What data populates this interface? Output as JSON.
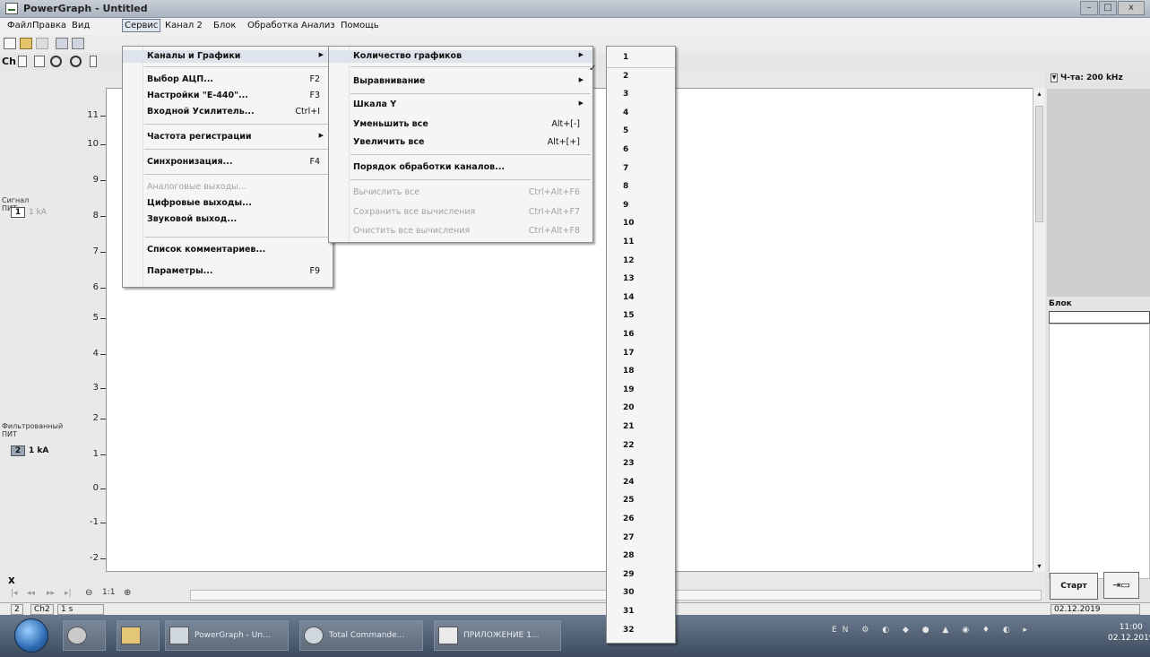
{
  "window": {
    "title": "PowerGraph - Untitled",
    "buttons": [
      "–",
      "□",
      "x"
    ]
  },
  "menubar": [
    "Файл",
    "Правка",
    "Вид",
    "Сервис",
    "Канал 2",
    "Блок",
    "Обработка",
    "Анализ",
    "Помощь"
  ],
  "toolbar2": {
    "ch_label": "Ch"
  },
  "right_panel": {
    "rate_label": "Ч-та: 200 kHz",
    "block_label": "Блок",
    "start_button": "Старт"
  },
  "left_panel": {
    "y_labels": [
      "11",
      "10",
      "9",
      "8",
      "7",
      "6",
      "5",
      "4",
      "3",
      "2",
      "1",
      "0",
      "-1",
      "-2"
    ],
    "channel1": {
      "name": "Сигнал ПИТ",
      "num": "1",
      "scale": "1 kA"
    },
    "channel2": {
      "name": "Фильтрованный ПИТ",
      "num": "2",
      "scale": "1 kA"
    }
  },
  "bottom": {
    "close": "x",
    "zoom_ratio": "1:1",
    "status": [
      "2",
      "Ch2",
      "1 s",
      "02.12.2019"
    ]
  },
  "taskbar": {
    "items": [
      "PowerGraph - Un...",
      "Total Commande...",
      "ПРИЛОЖЕНИЕ 1..."
    ],
    "tray": "EN",
    "clock_time": "11:00",
    "clock_date": "02.12.2019"
  },
  "menu_service": {
    "items": [
      {
        "label": "Каналы и Графики",
        "shortcut": "",
        "submenu": true,
        "disabled": false,
        "highlighted": true
      },
      {
        "label": "Выбор АЦП...",
        "shortcut": "F2",
        "submenu": false,
        "disabled": false
      },
      {
        "label": "Настройки \"E-440\"...",
        "shortcut": "F3",
        "submenu": false,
        "disabled": false
      },
      {
        "label": "Входной Усилитель...",
        "shortcut": "Ctrl+I",
        "submenu": false,
        "disabled": false
      },
      {
        "label": "Частота регистрации",
        "shortcut": "",
        "submenu": true,
        "disabled": false
      },
      {
        "label": "Синхронизация...",
        "shortcut": "F4",
        "submenu": false,
        "disabled": false
      },
      {
        "label": "Аналоговые выходы...",
        "shortcut": "",
        "submenu": false,
        "disabled": true
      },
      {
        "label": "Цифровые выходы...",
        "shortcut": "",
        "submenu": false,
        "disabled": false
      },
      {
        "label": "Звуковой выход...",
        "shortcut": "",
        "submenu": false,
        "disabled": false
      },
      {
        "label": "Список комментариев...",
        "shortcut": "",
        "submenu": false,
        "disabled": false
      },
      {
        "label": "Параметры...",
        "shortcut": "F9",
        "submenu": false,
        "disabled": false
      }
    ]
  },
  "menu_channels": {
    "items": [
      {
        "label": "Количество графиков",
        "shortcut": "",
        "submenu": true,
        "disabled": false,
        "highlighted": true
      },
      {
        "label": "Выравнивание",
        "shortcut": "",
        "submenu": true,
        "disabled": false
      },
      {
        "label": "Шкала Y",
        "shortcut": "",
        "submenu": true,
        "disabled": false
      },
      {
        "label": "Уменьшить все",
        "shortcut": "Alt+[-]",
        "submenu": false,
        "disabled": false
      },
      {
        "label": "Увеличить все",
        "shortcut": "Alt+[+]",
        "submenu": false,
        "disabled": false
      },
      {
        "label": "Порядок обработки каналов...",
        "shortcut": "",
        "submenu": false,
        "disabled": false
      },
      {
        "label": "Вычислить все",
        "shortcut": "Ctrl+Alt+F6",
        "submenu": false,
        "disabled": true
      },
      {
        "label": "Сохранить все вычисления",
        "shortcut": "Ctrl+Alt+F7",
        "submenu": false,
        "disabled": true
      },
      {
        "label": "Очистить все вычисления",
        "shortcut": "Ctrl+Alt+F8",
        "submenu": false,
        "disabled": true
      }
    ]
  },
  "menu_count": {
    "checked": "2",
    "check_mark": "✓",
    "items": [
      "1",
      "2",
      "3",
      "4",
      "5",
      "6",
      "7",
      "8",
      "9",
      "10",
      "11",
      "12",
      "13",
      "14",
      "15",
      "16",
      "17",
      "18",
      "19",
      "20",
      "21",
      "22",
      "23",
      "24",
      "25",
      "26",
      "27",
      "28",
      "29",
      "30",
      "31",
      "32"
    ]
  }
}
